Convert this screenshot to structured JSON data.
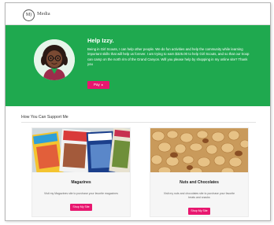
{
  "header": {
    "logo_text": "M)",
    "brand": "Media"
  },
  "hero": {
    "title": "Help Izzy.",
    "text": "Being in Girl Scouts, I can help other people. We do fun activities and help the community while learning important skills that will help us forever. I am trying to earn $325.00 to help Girl Scouts, and so that our troop can camp on the north rim of the Grand Canyon. Will you please help by shopping in my online site? Thank you",
    "pay_label": "Pay",
    "pay_icon": "arrow-right-icon",
    "background": "#1fa94f",
    "accent": "#e8176f"
  },
  "support": {
    "title": "How You Can Support Me"
  },
  "cards": [
    {
      "title": "Magazines",
      "description": "Visit my Magazines site to purchase your favorite magazines",
      "button": "Shop My Site"
    },
    {
      "title": "Nuts and Chocolates",
      "description": "Visit my nuts and chocolates site to purchase your favorite treats and snacks",
      "button": "Shop My Site"
    }
  ]
}
